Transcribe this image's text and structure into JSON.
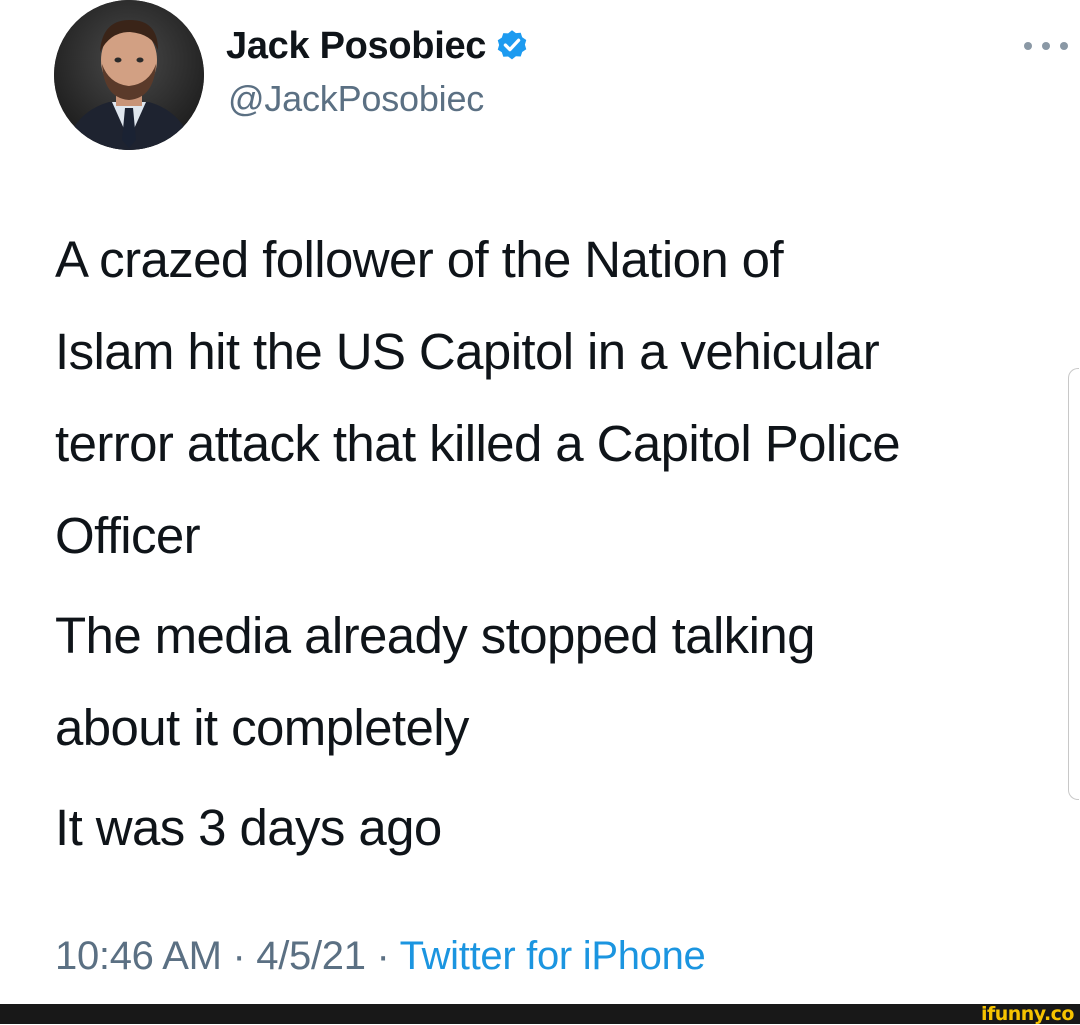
{
  "tweet": {
    "author": {
      "display_name": "Jack Posobiec",
      "handle": "@JackPosobiec",
      "verified": true
    },
    "paragraphs": [
      [
        "A crazed follower of the Nation of",
        "Islam hit the US Capitol in a vehicular",
        "terror attack that killed a Capitol Police",
        "Officer"
      ],
      [
        "The media already stopped talking",
        "about it completely"
      ],
      [
        "It was 3 days ago"
      ]
    ],
    "time": "10:46 AM",
    "separator": "·",
    "date": "4/5/21",
    "source": "Twitter for iPhone"
  },
  "watermark": "ifunny.co",
  "icons": {
    "verified": "verified-badge-icon",
    "more": "more-options-icon"
  },
  "colors": {
    "verified": "#1d9bf0",
    "link": "#1b95e0",
    "secondary_text": "#5b7083",
    "watermark": "#f6c300"
  }
}
